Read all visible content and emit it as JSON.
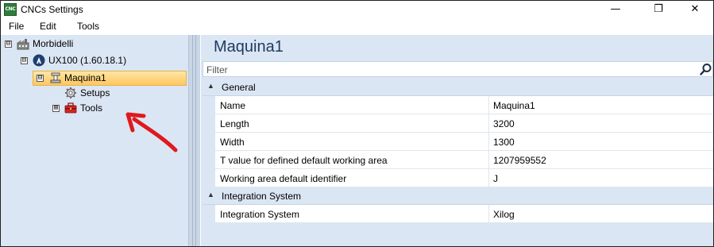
{
  "window": {
    "title": "CNCs Settings",
    "app_icon_text": "CNC",
    "controls": {
      "minimize": "—",
      "maximize": "❐",
      "close": "✕"
    }
  },
  "menu": {
    "file": "File",
    "edit": "Edit",
    "tools": "Tools"
  },
  "tree": {
    "nodes": [
      {
        "label": "Morbidelli",
        "expander": "⊟",
        "icon": "factory-icon"
      },
      {
        "label": "UX100 (1.60.18.1)",
        "expander": "⊟",
        "icon": "machine-logo-icon"
      },
      {
        "label": "Maquina1",
        "expander": "⊟",
        "icon": "machine-icon",
        "selected": true
      },
      {
        "label": "Setups",
        "icon": "gear-icon"
      },
      {
        "label": "Tools",
        "expander": "⊞",
        "icon": "toolbox-icon"
      }
    ]
  },
  "content": {
    "title": "Maquina1",
    "filter_placeholder": "Filter",
    "categories": [
      {
        "label": "General",
        "rows": [
          {
            "name": "Name",
            "value": "Maquina1"
          },
          {
            "name": "Length",
            "value": "3200"
          },
          {
            "name": "Width",
            "value": "1300"
          },
          {
            "name": "T value for defined default working area",
            "value": "1207959552"
          },
          {
            "name": "Working area default identifier",
            "value": "J"
          }
        ]
      },
      {
        "label": "Integration System",
        "rows": [
          {
            "name": "Integration System",
            "value": "Xilog"
          }
        ]
      }
    ]
  },
  "colors": {
    "tree_bg": "#dbe6f4",
    "selection": "#ffc660",
    "arrow": "#e0191e",
    "title": "#1f3b62"
  }
}
